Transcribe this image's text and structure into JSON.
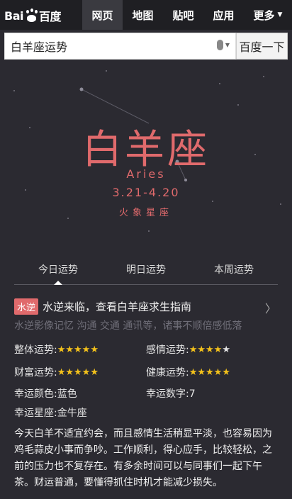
{
  "header": {
    "logo_text_left": "Bai",
    "logo_text_right": "百度",
    "tabs": [
      {
        "label": "网页",
        "active": true
      },
      {
        "label": "地图",
        "active": false
      },
      {
        "label": "贴吧",
        "active": false
      },
      {
        "label": "应用",
        "active": false
      },
      {
        "label": "更多",
        "active": false
      }
    ]
  },
  "search": {
    "value": "白羊座运势",
    "button_label": "百度一下",
    "icon": "microphone-icon"
  },
  "hero": {
    "title": "白羊座",
    "english": "Aries",
    "dates": "3.21-4.20",
    "element": "火象星座"
  },
  "fortune_tabs": [
    "今日运势",
    "明日运势",
    "本周运势"
  ],
  "notice": {
    "badge": "水逆",
    "text": "水逆来临，查看白羊座求生指南",
    "subtext": "水逆影像记忆 沟通 交通 通讯等，诸事不顺倍感低落"
  },
  "ratings": {
    "overall": {
      "label": "整体运势:",
      "stars": 5,
      "max": 5
    },
    "love": {
      "label": "感情运势:",
      "stars": 4,
      "max": 5
    },
    "wealth": {
      "label": "财富运势:",
      "stars": 5,
      "max": 5
    },
    "health": {
      "label": "健康运势:",
      "stars": 5,
      "max": 5
    }
  },
  "lucky": {
    "color": "幸运颜色:蓝色",
    "number": "幸运数字:7",
    "sign": "幸运星座:金牛座"
  },
  "description": "今天白羊不适宜约会，而且感情生活稍显平淡，也容易因为鸡毛蒜皮小事而争吵。工作顺利，得心应手，比较轻松，之前的压力也不复存在。有多余时间可以与同事们一起下午茶。财运普通，要懂得抓住时机才能减少损失。",
  "colors": {
    "accent": "#e06a6c",
    "background": "#2b2a31",
    "star": "#f4c21b"
  }
}
